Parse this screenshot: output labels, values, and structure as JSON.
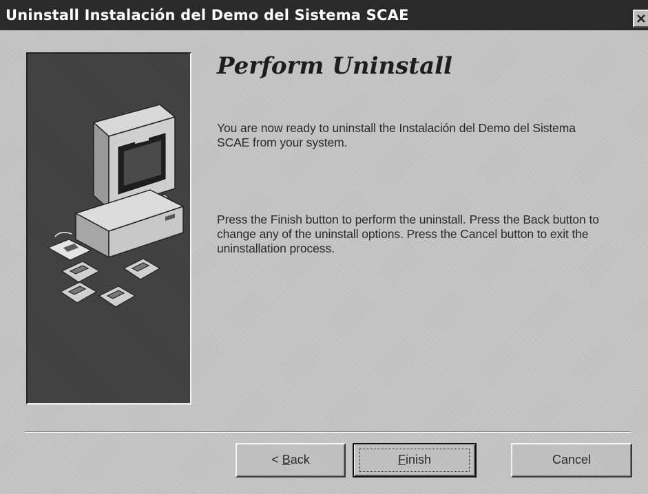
{
  "window": {
    "title": "Uninstall Instalación del Demo del Sistema SCAE"
  },
  "content": {
    "heading": "Perform Uninstall",
    "paragraph1": "You are now ready to uninstall the Instalación del Demo del Sistema SCAE from your system.",
    "paragraph2": "Press the Finish button to perform the uninstall.  Press the Back button to change any of the uninstall options.  Press the Cancel button to exit the uninstallation process."
  },
  "buttons": {
    "back_prefix": "< ",
    "back_mnemonic": "B",
    "back_rest": "ack",
    "finish_mnemonic": "F",
    "finish_rest": "inish",
    "cancel": "Cancel"
  },
  "icons": {
    "close": "close-icon",
    "illustration": "computer-with-floppy-disks-illustration"
  }
}
